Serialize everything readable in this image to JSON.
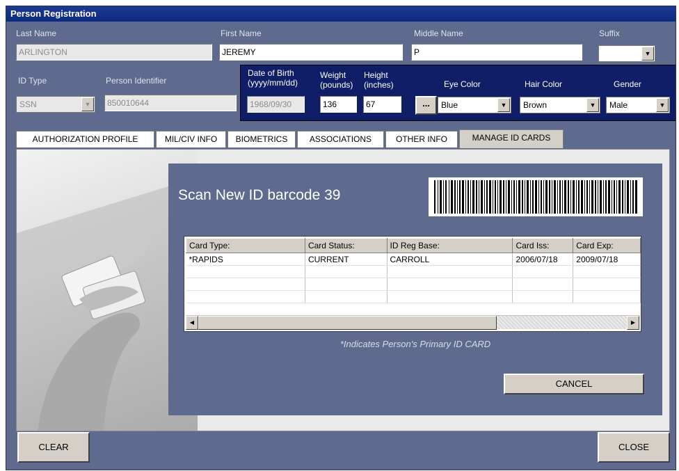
{
  "window": {
    "title": "Person Registration"
  },
  "person": {
    "last_name_label": "Last Name",
    "last_name": "ARLINGTON",
    "first_name_label": "First Name",
    "first_name": "JEREMY",
    "middle_name_label": "Middle Name",
    "middle_name": "P",
    "suffix_label": "Suffix",
    "suffix": ""
  },
  "identity": {
    "id_type_label": "ID Type",
    "id_type": "SSN",
    "person_identifier_label": "Person Identifier",
    "person_identifier": "850010644",
    "dob_label_1": "Date of Birth",
    "dob_label_2": "(yyyy/mm/dd)",
    "dob": "1968/09/30",
    "weight_label_1": "Weight",
    "weight_label_2": "(pounds)",
    "weight": "136",
    "height_label_1": "Height",
    "height_label_2": "(inches)",
    "height": "67",
    "ellipsis_label": "...",
    "eye_color_label": "Eye Color",
    "eye_color": "Blue",
    "hair_color_label": "Hair Color",
    "hair_color": "Brown",
    "gender_label": "Gender",
    "gender": "Male"
  },
  "tabs": [
    {
      "label": "AUTHORIZATION PROFILE"
    },
    {
      "label": "MIL/CIV INFO"
    },
    {
      "label": "BIOMETRICS"
    },
    {
      "label": "ASSOCIATIONS"
    },
    {
      "label": "OTHER INFO"
    },
    {
      "label": "MANAGE ID CARDS"
    }
  ],
  "manage_cards": {
    "scan_title": "Scan New ID barcode 39",
    "columns": [
      "Card Type:",
      "Card Status:",
      "ID Reg Base:",
      "Card Iss:",
      "Card Exp:"
    ],
    "rows": [
      {
        "type": "*RAPIDS",
        "status": "CURRENT",
        "base": "CARROLL",
        "issued": "2006/07/18",
        "expires": "2009/07/18"
      }
    ],
    "footnote": "*Indicates Person's Primary ID CARD",
    "cancel_label": "CANCEL"
  },
  "buttons": {
    "clear": "CLEAR",
    "close": "CLOSE"
  },
  "colors": {
    "window_bg": "#5f6b8e",
    "title_bar": "#0d2a80",
    "dob_panel": "#0f1e66"
  },
  "icons": {
    "dropdown": "chevron-down-icon",
    "scroll_left": "arrow-left-icon",
    "scroll_right": "arrow-right-icon"
  }
}
